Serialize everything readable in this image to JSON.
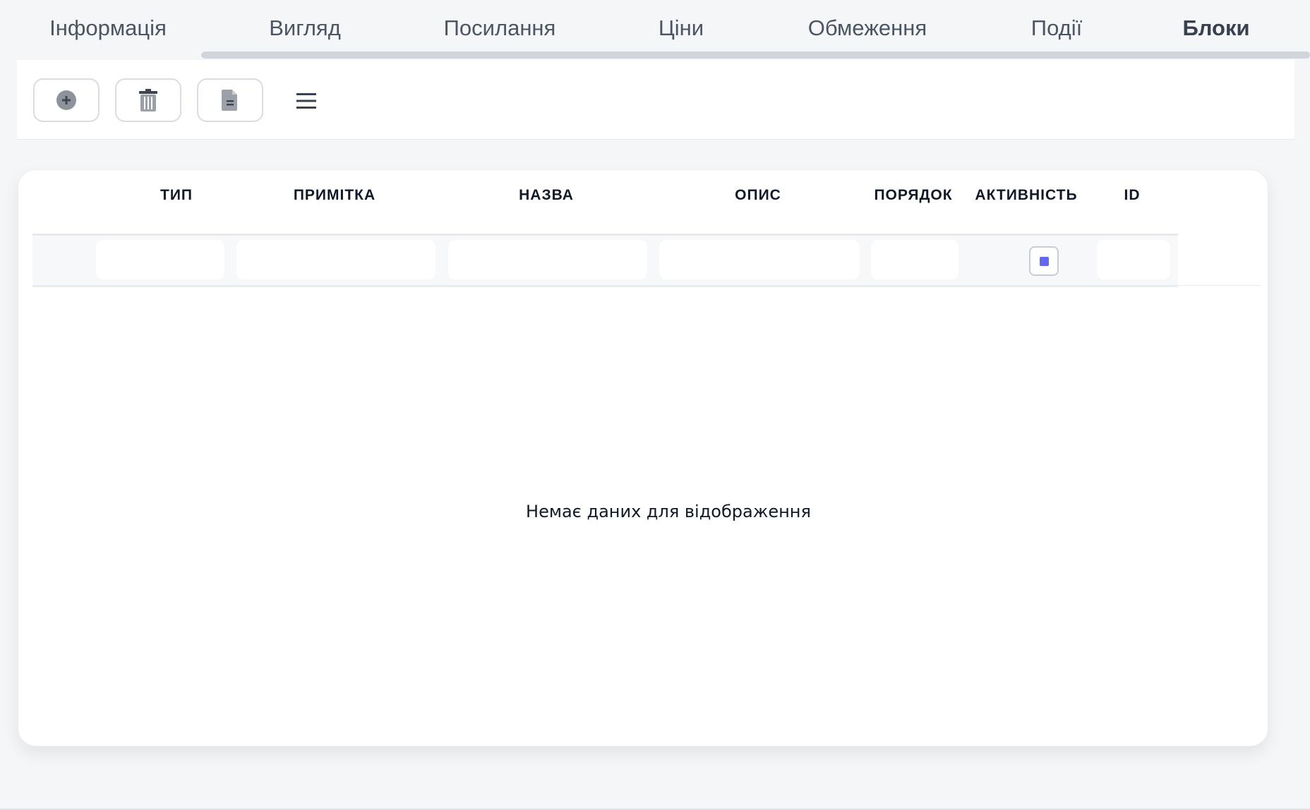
{
  "tabs": [
    {
      "label": "Інформація",
      "active": false
    },
    {
      "label": "Вигляд",
      "active": false
    },
    {
      "label": "Посилання",
      "active": false
    },
    {
      "label": "Ціни",
      "active": false
    },
    {
      "label": "Обмеження",
      "active": false
    },
    {
      "label": "Події",
      "active": false
    },
    {
      "label": "Блоки",
      "active": true
    }
  ],
  "toolbar": {
    "buttons": [
      {
        "icon": "add-circle-icon"
      },
      {
        "icon": "trash-icon"
      },
      {
        "icon": "document-icon"
      },
      {
        "icon": "hamburger-menu-icon"
      }
    ]
  },
  "grid": {
    "columns": [
      {
        "label": "ТИП"
      },
      {
        "label": "ПРИМІТКА"
      },
      {
        "label": "НАЗВА"
      },
      {
        "label": "ОПИС"
      },
      {
        "label": "ПОРЯДОК"
      },
      {
        "label": "АКТИВНІСТЬ"
      },
      {
        "label": "ID"
      }
    ],
    "rows": [],
    "empty_message": "Немає даних для відображення"
  },
  "colors": {
    "accent": "#6366f1",
    "icon_gray": "#8e939b",
    "icon_dark": "#3f4650"
  }
}
